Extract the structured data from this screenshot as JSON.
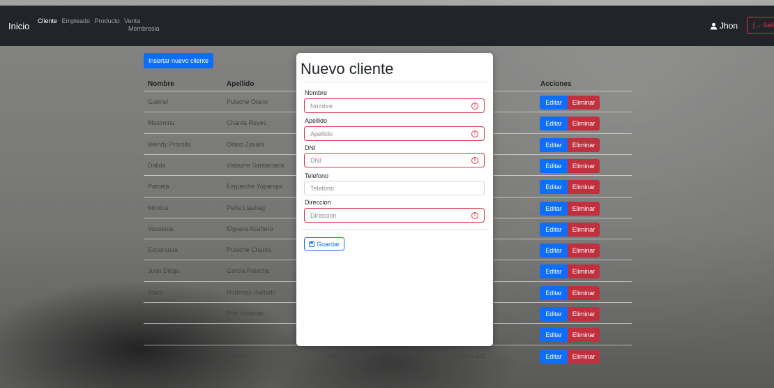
{
  "navbar": {
    "brand": "Inicio",
    "links": [
      "Cliente",
      "Empleado",
      "Producto",
      "Venta",
      "Membresia"
    ],
    "active": "Cliente",
    "user": "Jhon",
    "logout": "Salir"
  },
  "insert_button": "Insertar nuevo cliente",
  "table": {
    "headers": {
      "nombre": "Nombre",
      "apellido": "Apellido",
      "acciones": "Acciones"
    },
    "rows": [
      {
        "nombre": "Gabriel",
        "apellido": "Pulache Olano"
      },
      {
        "nombre": "Maximina",
        "apellido": "Chanta Reyes"
      },
      {
        "nombre": "Wendy Priscilla",
        "apellido": "Olano Zavala"
      },
      {
        "nombre": "Dalida",
        "apellido": "Vidaurre Santamaria"
      },
      {
        "nombre": "Pamela",
        "apellido": "Esqueche Yupanqui"
      },
      {
        "nombre": "Monica",
        "apellido": "Peña Llashag"
      },
      {
        "nombre": "Yessenia",
        "apellido": "Elguera Asañero"
      },
      {
        "nombre": "Esperanza",
        "apellido": "Pulache Chanta"
      },
      {
        "nombre": "Juan Diego",
        "apellido": "Garcia Pulache"
      },
      {
        "nombre": "Stacy",
        "apellido": "Rodenas Hurtado"
      },
      {
        "nombre": "",
        "apellido": "Polo Huaman"
      },
      {
        "nombre": "",
        "apellido": ""
      },
      {
        "nombre": "",
        "apellido": "Hurtado",
        "dni": "55555555",
        "direccion": "Av Francia 122"
      }
    ],
    "edit_label": "Editar",
    "delete_label": "Eliminar"
  },
  "modal": {
    "title": "Nuevo cliente",
    "fields": [
      {
        "label": "Nombre",
        "placeholder": "Nombre",
        "invalid": true
      },
      {
        "label": "Apellido",
        "placeholder": "Apellido",
        "invalid": true
      },
      {
        "label": "DNI",
        "placeholder": "DNI",
        "invalid": true
      },
      {
        "label": "Telefono",
        "placeholder": "Telefono",
        "invalid": false
      },
      {
        "label": "Direccion",
        "placeholder": "Direccion",
        "invalid": true
      }
    ],
    "save_label": "Guardar"
  },
  "colors": {
    "primary": "#0d6efd",
    "danger": "#dc3545",
    "navbar": "#212529"
  }
}
